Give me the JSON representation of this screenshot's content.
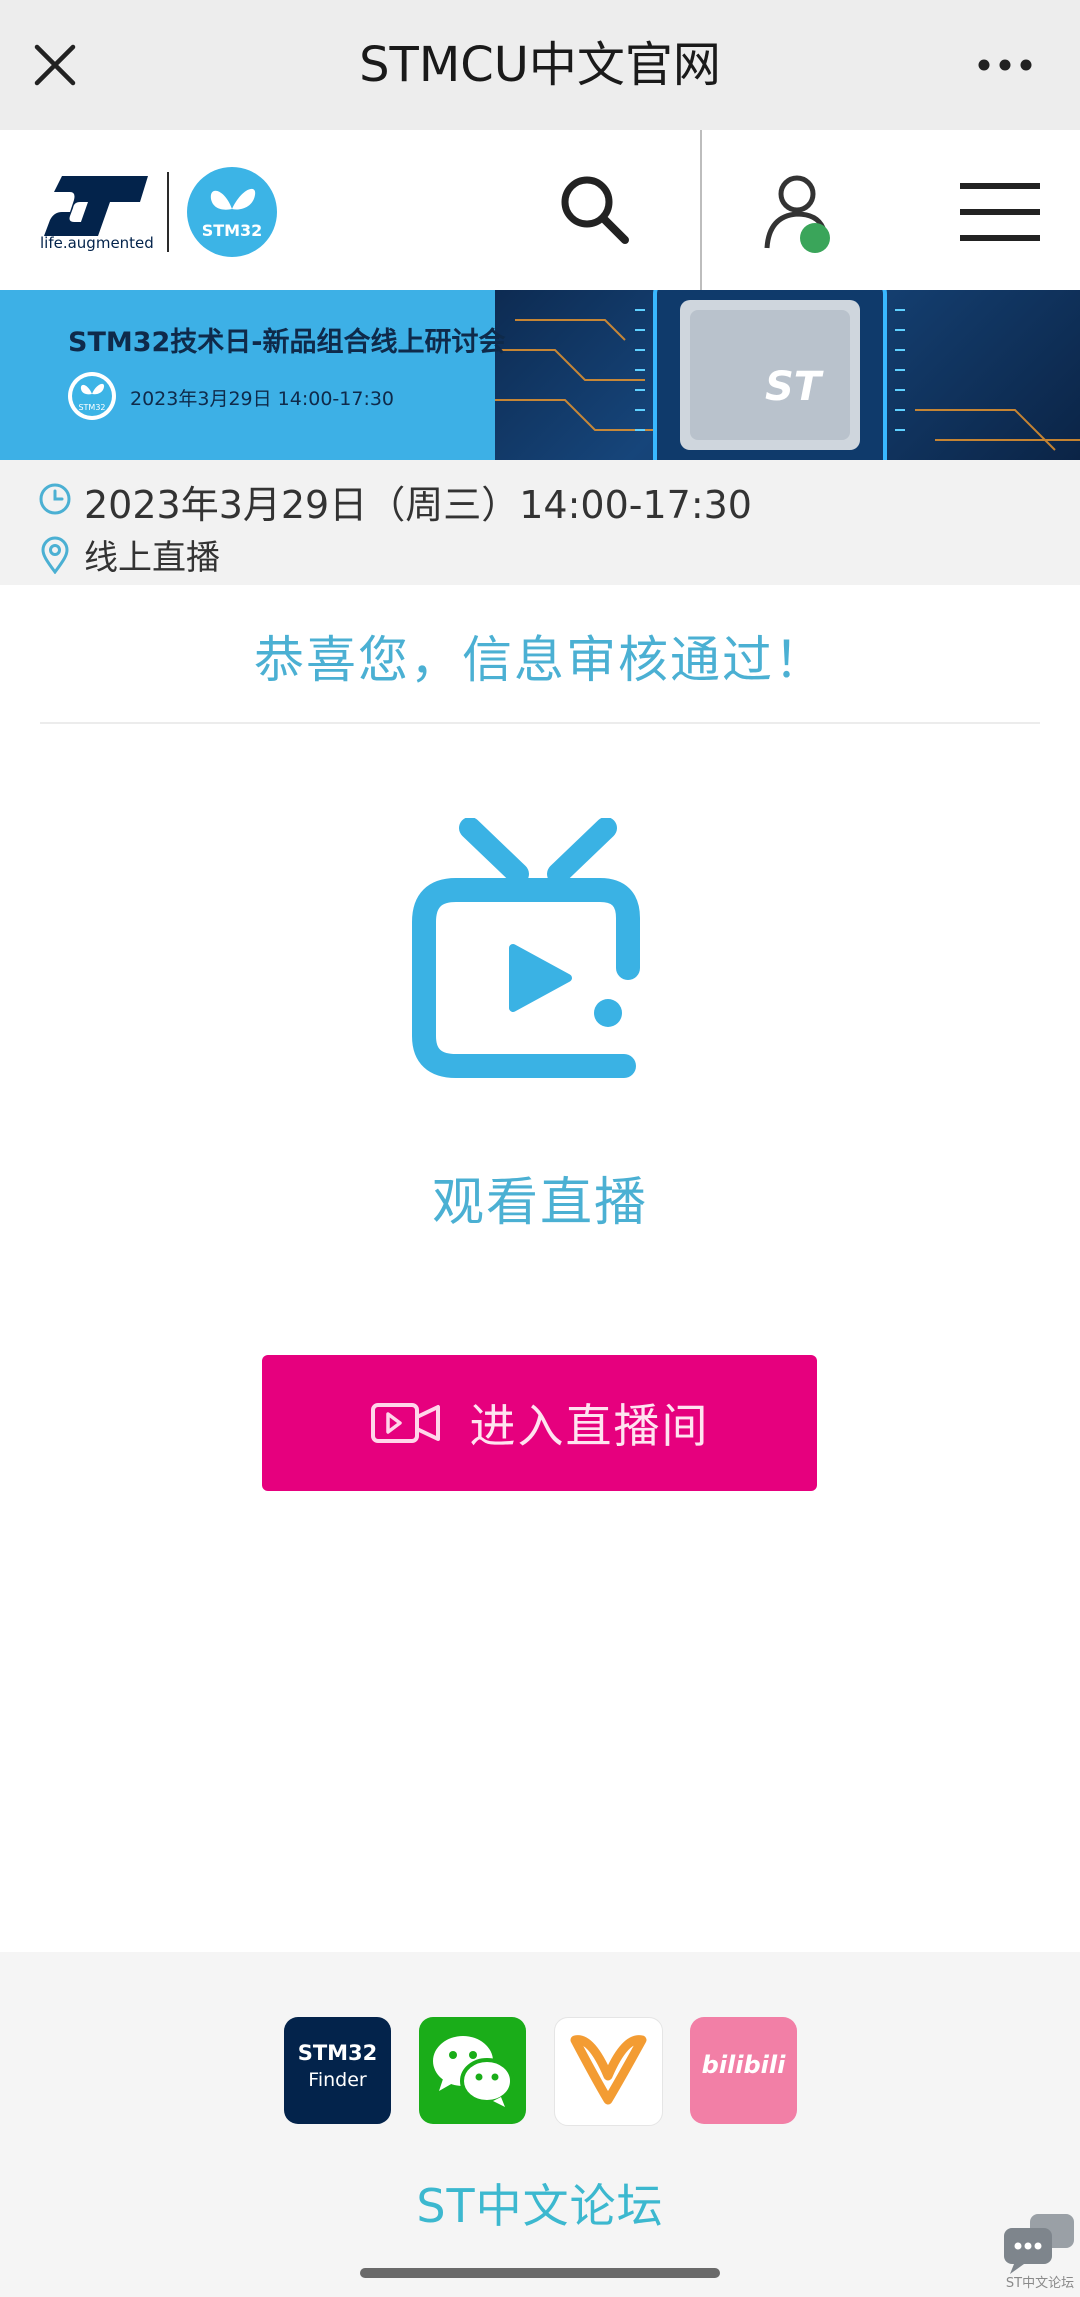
{
  "wechat_bar": {
    "title": "STMCU中文官网",
    "close_icon": "close-icon",
    "more_icon": "more-icon"
  },
  "site_header": {
    "logo_tagline": "life.augmented",
    "badge_text": "STM32",
    "icons": [
      "search-icon",
      "user-icon",
      "menu-icon"
    ],
    "online_dot_color": "#3aa55a"
  },
  "banner": {
    "title": "STM32技术日-新品组合线上研讨会",
    "date": "2023年3月29日 14:00-17:30",
    "badge_text": "STM32",
    "chip_logo_text": "ST"
  },
  "event_info": {
    "time": "2023年3月29日（周三）14:00-17:30",
    "location": "线上直播"
  },
  "status": {
    "message": "恭喜您，信息审核通过！"
  },
  "live": {
    "heading": "观看直播",
    "enter_button": "进入直播间",
    "accent_color": "#4bb0d3",
    "button_color": "#e6007e"
  },
  "footer": {
    "socials": [
      {
        "name": "stm32-finder",
        "line1": "STM32",
        "line2": "Finder"
      },
      {
        "name": "wechat"
      },
      {
        "name": "weibo-like"
      },
      {
        "name": "bilibili",
        "text": "bilibili"
      }
    ],
    "forum_link": "ST中文论坛",
    "forum_badge_text": "ST中文论坛"
  }
}
